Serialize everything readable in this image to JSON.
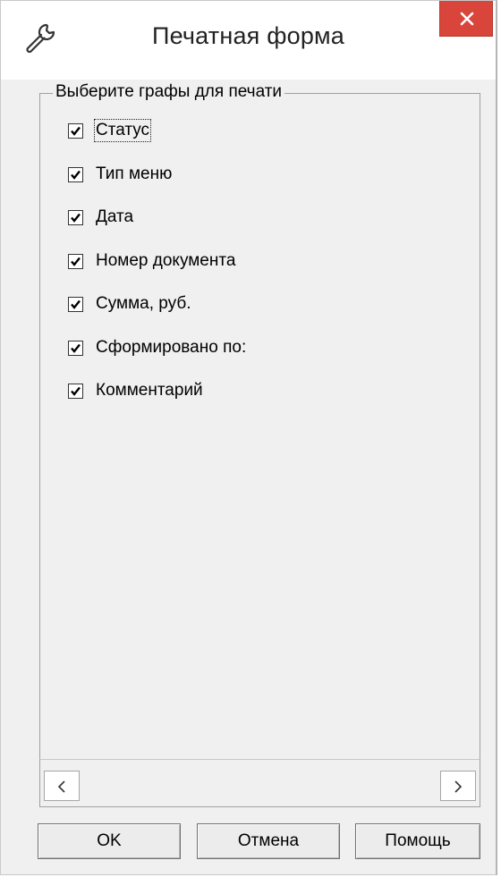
{
  "window": {
    "title": "Печатная форма",
    "close_icon": "close-icon",
    "app_icon": "wrench-icon"
  },
  "group": {
    "title": "Выберите графы для печати"
  },
  "columns": [
    {
      "label": "Статус",
      "checked": true
    },
    {
      "label": "Тип меню",
      "checked": true
    },
    {
      "label": "Дата",
      "checked": true
    },
    {
      "label": "Номер документа",
      "checked": true
    },
    {
      "label": "Сумма, руб.",
      "checked": true
    },
    {
      "label": "Сформировано по:",
      "checked": true
    },
    {
      "label": "Комментарий",
      "checked": true
    }
  ],
  "scrollbar": {
    "left_icon": "chevron-left-icon",
    "right_icon": "chevron-right-icon"
  },
  "buttons": {
    "ok": "OK",
    "cancel": "Отмена",
    "help": "Помощь"
  },
  "colors": {
    "close_button": "#d9453b",
    "window_bg": "#f0f0f0"
  }
}
